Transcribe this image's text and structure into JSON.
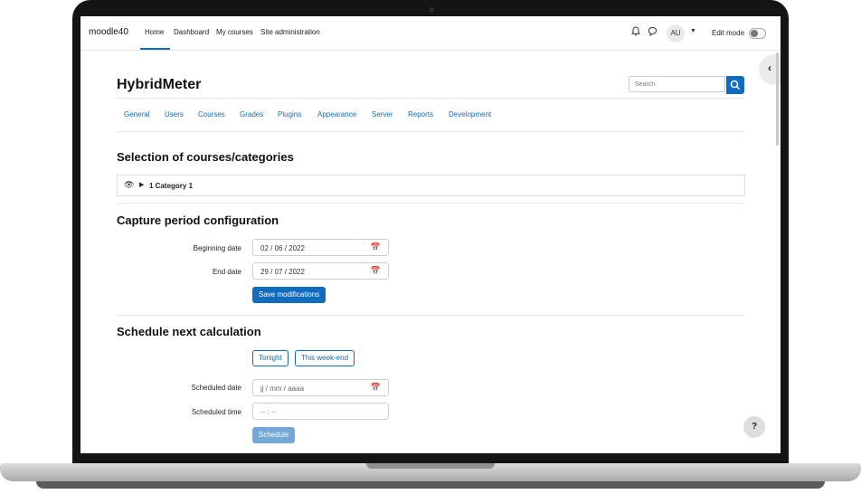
{
  "navbar": {
    "brand": "moodle40",
    "items": [
      "Home",
      "Dashboard",
      "My courses",
      "Site administration"
    ],
    "user_initials": "AU",
    "edit_mode_label": "Edit mode"
  },
  "header": {
    "title": "HybridMeter",
    "search_placeholder": "Search"
  },
  "admin_tabs": [
    "General",
    "Users",
    "Courses",
    "Grades",
    "Plugins",
    "Appearance",
    "Server",
    "Reports",
    "Development"
  ],
  "selection": {
    "heading": "Selection of courses/categories",
    "category_label": "1 Category 1"
  },
  "capture": {
    "heading": "Capture period configuration",
    "beginning_label": "Beginning date",
    "beginning_value": "02 / 06 / 2022",
    "end_label": "End date",
    "end_value": "29 / 07 / 2022",
    "save_button": "Save modifications"
  },
  "schedule": {
    "heading": "Schedule next calculation",
    "tonight_button": "Tonight",
    "weekend_button": "This week-end",
    "date_label": "Scheduled date",
    "date_placeholder": "jj / mm / aaaa",
    "time_label": "Scheduled time",
    "time_placeholder": "-- : --",
    "schedule_button": "Schedule"
  },
  "help": "?",
  "colors": {
    "primary": "#0f6cbf",
    "primary_disabled": "#73a7d7"
  },
  "icons": [
    "bell-icon",
    "chat-icon",
    "chevron-down-icon",
    "chevron-left-icon",
    "search-icon",
    "eye-icon",
    "triangle-right-icon",
    "calendar-icon"
  ]
}
